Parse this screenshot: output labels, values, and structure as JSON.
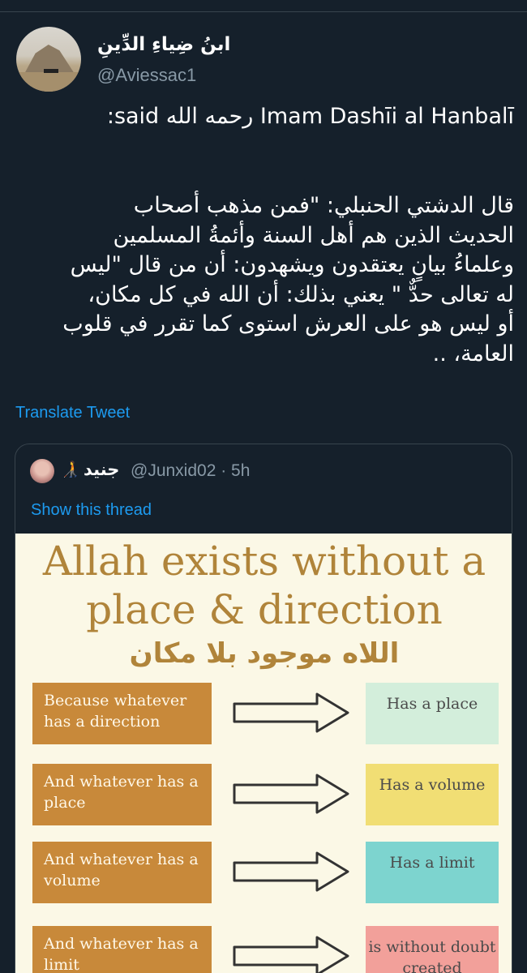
{
  "tweet": {
    "display_name": "ابنُ ضِياءِ الدِّينِ",
    "handle": "@Aviessac1",
    "text_line1": "Imam Dashīi al Hanbalī رحمه الله said:",
    "arabic_text": "قال الدشتي الحنبلي: \"فمن مذهب أصحاب\nالحديث الذين هم أهل السنة وأئمةُ المسلمين\nوعلماءُ بيانٍ يعتقدون ويشهدون: أن من قال \"ليس\nله تعالى حدٌّ \" يعني بذلك: أن الله في كل مكان،\nأو ليس هو على العرش استوى كما تقرر في قلوب\nالعامة، ..",
    "translate_label": "Translate Tweet"
  },
  "quote": {
    "emoji": "🧑‍🦯",
    "name": "جنيد",
    "handle_time": "@Junxid02 · 5h",
    "show_thread": "Show this thread",
    "image": {
      "title_line1": "Allah exists without a",
      "title_line2": "place & direction",
      "arabic_title": "اللاه موجود بلا مكان",
      "rows": [
        {
          "left": "Because whatever has a direction",
          "right": "Has a place",
          "right_color": "#d3eedb"
        },
        {
          "left": "And whatever has a place",
          "right": "Has a volume",
          "right_color": "#f1de74"
        },
        {
          "left": "And whatever has a volume",
          "right": "Has a limit",
          "right_color": "#7dd4cf"
        },
        {
          "left": "And whatever has a limit",
          "right": "is without doubt created",
          "right_color": "#f2a09a"
        }
      ]
    }
  },
  "colors": {
    "background": "#15202b",
    "accent": "#1d9bf0",
    "muted": "#8899a6",
    "infographic_gold": "#b0843a",
    "box_brown": "#c8893a"
  }
}
